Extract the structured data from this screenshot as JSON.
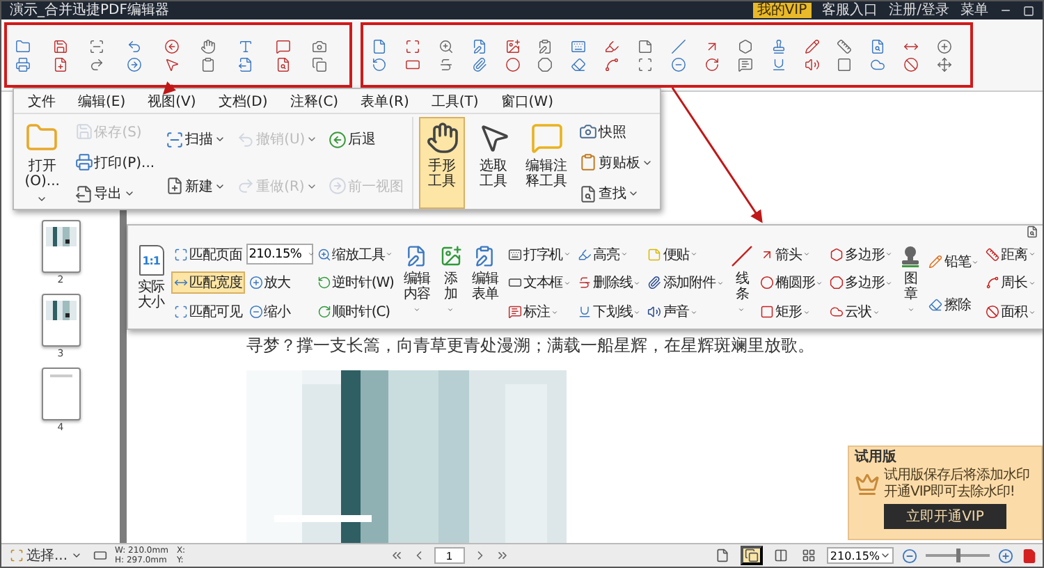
{
  "title_bar": {
    "title": "演示_合并迅捷PDF编辑器",
    "vip": "我的VIP",
    "links": [
      "客服入口",
      "注册/登录",
      "菜单"
    ]
  },
  "menu_callout": {
    "menu": [
      "文件",
      "编辑(E)",
      "视图(V)",
      "文档(D)",
      "注释(C)",
      "表单(R)",
      "工具(T)",
      "窗口(W)"
    ],
    "groups": [
      {
        "kind": "large",
        "items": [
          {
            "label": "打开(O)...",
            "dropdown": true,
            "selected": false
          }
        ]
      },
      {
        "kind": "stack",
        "items": [
          {
            "label": "保存(S)",
            "dropdown": false,
            "disabled": true
          },
          {
            "label": "打印(P)...",
            "dropdown": false,
            "disabled": false
          },
          {
            "label": "导出",
            "dropdown": true,
            "disabled": false
          }
        ]
      },
      {
        "kind": "stack",
        "items": [
          {
            "label": "扫描",
            "dropdown": true,
            "disabled": false
          },
          {
            "label": "新建",
            "dropdown": true,
            "disabled": false
          }
        ]
      },
      {
        "kind": "stack",
        "items": [
          {
            "label": "撤销(U)",
            "dropdown": true,
            "disabled": true
          },
          {
            "label": "重做(R)",
            "dropdown": true,
            "disabled": true
          }
        ]
      },
      {
        "kind": "stack",
        "items": [
          {
            "label": "后退",
            "dropdown": false,
            "disabled": false
          },
          {
            "label": "前一视图",
            "dropdown": false,
            "disabled": true
          }
        ]
      },
      {
        "kind": "large",
        "items": [
          {
            "label": "手形工具",
            "dropdown": false,
            "selected": true
          }
        ]
      },
      {
        "kind": "large",
        "items": [
          {
            "label": "选取工具",
            "dropdown": false,
            "selected": false
          }
        ]
      },
      {
        "kind": "large",
        "items": [
          {
            "label": "编辑注释工具",
            "dropdown": false,
            "selected": false
          }
        ]
      },
      {
        "kind": "stack",
        "items": [
          {
            "label": "快照",
            "dropdown": false,
            "disabled": false
          },
          {
            "label": "剪贴板",
            "dropdown": true,
            "disabled": false
          },
          {
            "label": "查找",
            "dropdown": true,
            "disabled": false
          }
        ]
      }
    ]
  },
  "view_callout": {
    "groups": [
      {
        "kind": "large",
        "items": [
          {
            "label": "实际大小",
            "glyph": "1:1",
            "dropdown": false,
            "selected": false
          }
        ]
      },
      {
        "kind": "stack",
        "items": [
          {
            "kind": "button",
            "label": "匹配页面",
            "dropdown": false,
            "selected": false
          },
          {
            "kind": "button",
            "label": "匹配宽度",
            "dropdown": false,
            "selected": true
          },
          {
            "kind": "button",
            "label": "匹配可见",
            "dropdown": false,
            "selected": false
          }
        ]
      },
      {
        "kind": "stack",
        "items": [
          {
            "kind": "field",
            "value": "210.15%"
          },
          {
            "kind": "button",
            "label": "放大",
            "dropdown": false,
            "selected": false
          },
          {
            "kind": "button",
            "label": "缩小",
            "dropdown": false,
            "selected": false
          }
        ]
      },
      {
        "kind": "stack",
        "items": [
          {
            "kind": "button",
            "label": "缩放工具",
            "dropdown": true,
            "selected": false
          },
          {
            "kind": "button",
            "label": "逆时针(W)",
            "dropdown": false,
            "selected": false
          },
          {
            "kind": "button",
            "label": "顺时针(C)",
            "dropdown": false,
            "selected": false
          }
        ]
      },
      {
        "kind": "large",
        "items": [
          {
            "label": "编辑内容",
            "dropdown": true,
            "selected": false
          }
        ]
      },
      {
        "kind": "large",
        "items": [
          {
            "label": "添加",
            "dropdown": true,
            "selected": false
          }
        ]
      },
      {
        "kind": "large",
        "items": [
          {
            "label": "编辑表单",
            "dropdown": false,
            "selected": false
          }
        ]
      },
      {
        "kind": "stack",
        "items": [
          {
            "kind": "button",
            "label": "打字机",
            "dropdown": true,
            "selected": false
          },
          {
            "kind": "button",
            "label": "文本框",
            "dropdown": true,
            "selected": false
          },
          {
            "kind": "button",
            "label": "标注",
            "dropdown": true,
            "selected": false
          }
        ]
      },
      {
        "kind": "stack",
        "items": [
          {
            "kind": "button",
            "label": "高亮",
            "dropdown": true,
            "selected": false
          },
          {
            "kind": "button",
            "label": "删除线",
            "dropdown": true,
            "selected": false
          },
          {
            "kind": "button",
            "label": "下划线",
            "dropdown": true,
            "selected": false
          }
        ]
      },
      {
        "kind": "stack",
        "items": [
          {
            "kind": "button",
            "label": "便贴",
            "dropdown": true,
            "selected": false
          },
          {
            "kind": "button",
            "label": "添加附件",
            "dropdown": true,
            "selected": false
          },
          {
            "kind": "button",
            "label": "声音",
            "dropdown": true,
            "selected": false
          }
        ]
      },
      {
        "kind": "large",
        "items": [
          {
            "label": "线条",
            "dropdown": true,
            "selected": false
          }
        ]
      },
      {
        "kind": "stack",
        "items": [
          {
            "kind": "button",
            "label": "箭头",
            "dropdown": true,
            "selected": false
          },
          {
            "kind": "button",
            "label": "椭圆形",
            "dropdown": true,
            "selected": false
          },
          {
            "kind": "button",
            "label": "矩形",
            "dropdown": true,
            "selected": false
          }
        ]
      },
      {
        "kind": "stack",
        "items": [
          {
            "kind": "button",
            "label": "多边形",
            "dropdown": true,
            "selected": false
          },
          {
            "kind": "button",
            "label": "多边形",
            "dropdown": true,
            "selected": false
          },
          {
            "kind": "button",
            "label": "云状",
            "dropdown": true,
            "selected": false
          }
        ]
      },
      {
        "kind": "large",
        "items": [
          {
            "label": "图章",
            "dropdown": true,
            "selected": false
          }
        ]
      },
      {
        "kind": "stack",
        "items": [
          {
            "kind": "button",
            "label": "铅笔",
            "dropdown": true,
            "selected": false
          },
          {
            "kind": "button",
            "label": "擦除",
            "dropdown": false,
            "selected": false
          }
        ]
      },
      {
        "kind": "stack",
        "items": [
          {
            "kind": "button",
            "label": "距离",
            "dropdown": true,
            "selected": false
          },
          {
            "kind": "button",
            "label": "周长",
            "dropdown": true,
            "selected": false
          },
          {
            "kind": "button",
            "label": "面积",
            "dropdown": true,
            "selected": false
          }
        ]
      }
    ]
  },
  "thumbnails": [
    {
      "number": "2",
      "kind": "picture"
    },
    {
      "number": "3",
      "kind": "picture"
    },
    {
      "number": "4",
      "kind": "blank"
    }
  ],
  "document": {
    "text": "寻梦？撑一支长篙，向青草更青处漫溯；满载一船星辉，在星辉斑斓里放歌。"
  },
  "trial_popup": {
    "title": "试用版",
    "lines": [
      "试用版保存后将添加水印",
      "开通VIP即可去除水印!"
    ],
    "button": "立即开通VIP"
  },
  "status_bar": {
    "select": "选择...",
    "width": "W: 210.0mm",
    "height": "H: 297.0mm",
    "x": "X:",
    "y": "Y:",
    "page": "1",
    "views": [
      {
        "selected": false
      },
      {
        "selected": true
      },
      {
        "selected": false
      },
      {
        "selected": false
      }
    ],
    "zoom": "210.15%",
    "zoom_slider": {
      "level": 0.5
    }
  }
}
